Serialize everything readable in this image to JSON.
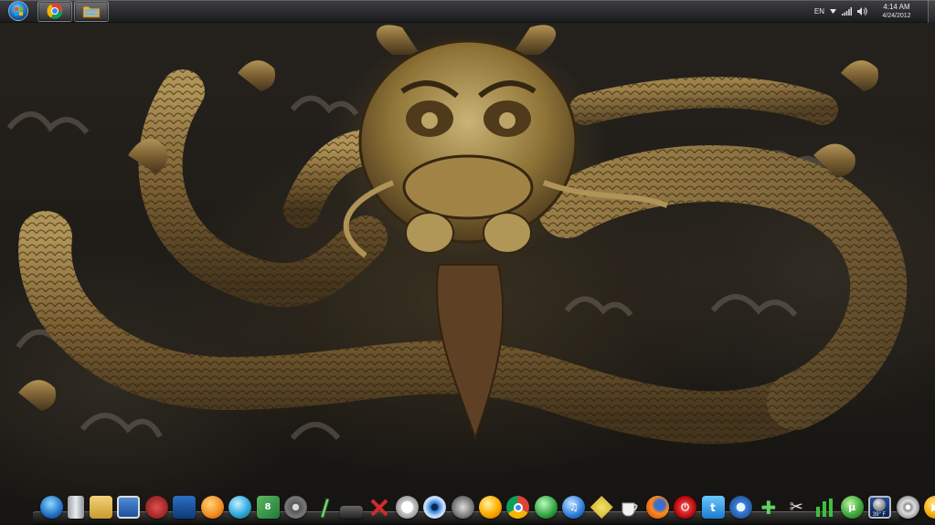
{
  "taskbar": {
    "start_button": {
      "icon": "windows-logo-icon"
    },
    "pinned": [
      {
        "name": "chrome",
        "icon": "chrome-icon"
      },
      {
        "name": "explorer",
        "icon": "folder-icon"
      }
    ],
    "tray": {
      "language": "EN",
      "icons": [
        "network-signal-icon",
        "volume-icon"
      ],
      "time": "4:14 AM",
      "date": "4/24/2012"
    }
  },
  "dock": {
    "icons": [
      "windows-start-icon",
      "recycle-bin-icon",
      "documents-folder-icon",
      "computer-icon",
      "media-player-icon",
      "picture-viewer-icon",
      "firefox-orange-icon",
      "media-center-icon",
      "windows-8-icon",
      "film-reel-icon",
      "pen-tool-icon",
      "scanner-icon",
      "tools-icon",
      "safari-icon",
      "eye-icon",
      "theater-masks-icon",
      "orange-ball-icon",
      "chrome-icon",
      "globe-icon",
      "music-note-icon",
      "sketch-icon",
      "coffee-cup-icon",
      "firefox-icon",
      "power-icon",
      "twitter-icon",
      "blue-gear-icon",
      "green-cross-icon",
      "scissors-icon",
      "chart-bars-icon",
      "utorrent-icon",
      "video-editor-icon",
      "reel-icon",
      "play-button-icon",
      "desktop-icon"
    ],
    "weather": {
      "icon": "weather-moon-icon",
      "temperature": "39° F"
    }
  },
  "colors": {
    "taskbar": "#2a2c31",
    "bronze": "#a8874a",
    "background": "#24211c"
  }
}
